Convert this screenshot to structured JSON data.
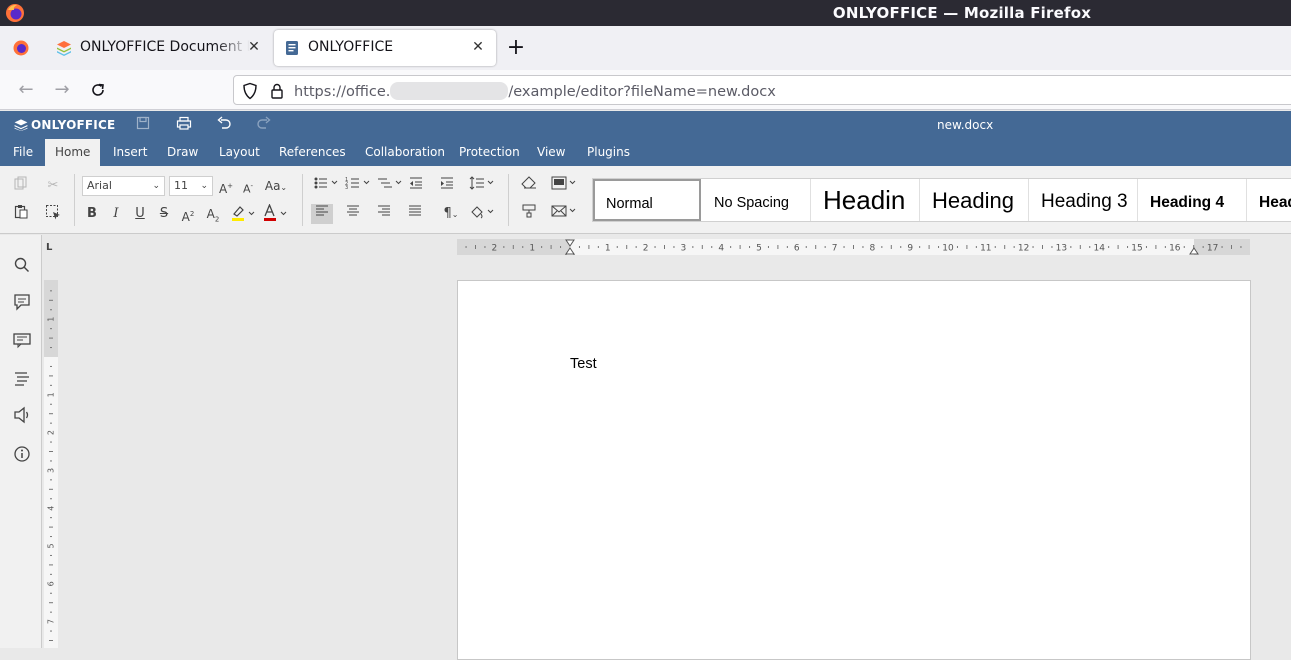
{
  "browser": {
    "window_title": "ONLYOFFICE — Mozilla Firefox",
    "tabs": [
      {
        "label": "ONLYOFFICE Document Editor",
        "active": false
      },
      {
        "label": "ONLYOFFICE",
        "active": true
      }
    ],
    "url": "https://office.",
    "url_suffix": "/example/editor?fileName=new.docx"
  },
  "editor": {
    "brand": "ONLYOFFICE",
    "doc_name": "new.docx",
    "menu_tabs": [
      "File",
      "Home",
      "Insert",
      "Draw",
      "Layout",
      "References",
      "Collaboration",
      "Protection",
      "View",
      "Plugins"
    ],
    "active_tab": "Home",
    "font_name": "Arial",
    "font_size": "11",
    "styles": [
      "Normal",
      "No Spacing",
      "Headin",
      "Heading",
      "Heading 3",
      "Heading 4",
      "Head"
    ],
    "ruler_h_labels": [
      "2",
      "1",
      "1",
      "2",
      "3",
      "4",
      "5",
      "6",
      "7",
      "8",
      "9",
      "10",
      "11",
      "12",
      "13",
      "14",
      "15",
      "16",
      "17"
    ],
    "ruler_v_labels": [
      "1",
      "1",
      "2",
      "3",
      "4",
      "5",
      "6",
      "7"
    ],
    "ruler_corner": "L",
    "document_text": "Test"
  },
  "colors": {
    "header_bg": "#446995",
    "toolbar_bg": "#f1f1f1",
    "firefox_titlebar": "#2b2a33",
    "highlight_yellow": "#ffeb00",
    "font_color_red": "#d00000"
  }
}
